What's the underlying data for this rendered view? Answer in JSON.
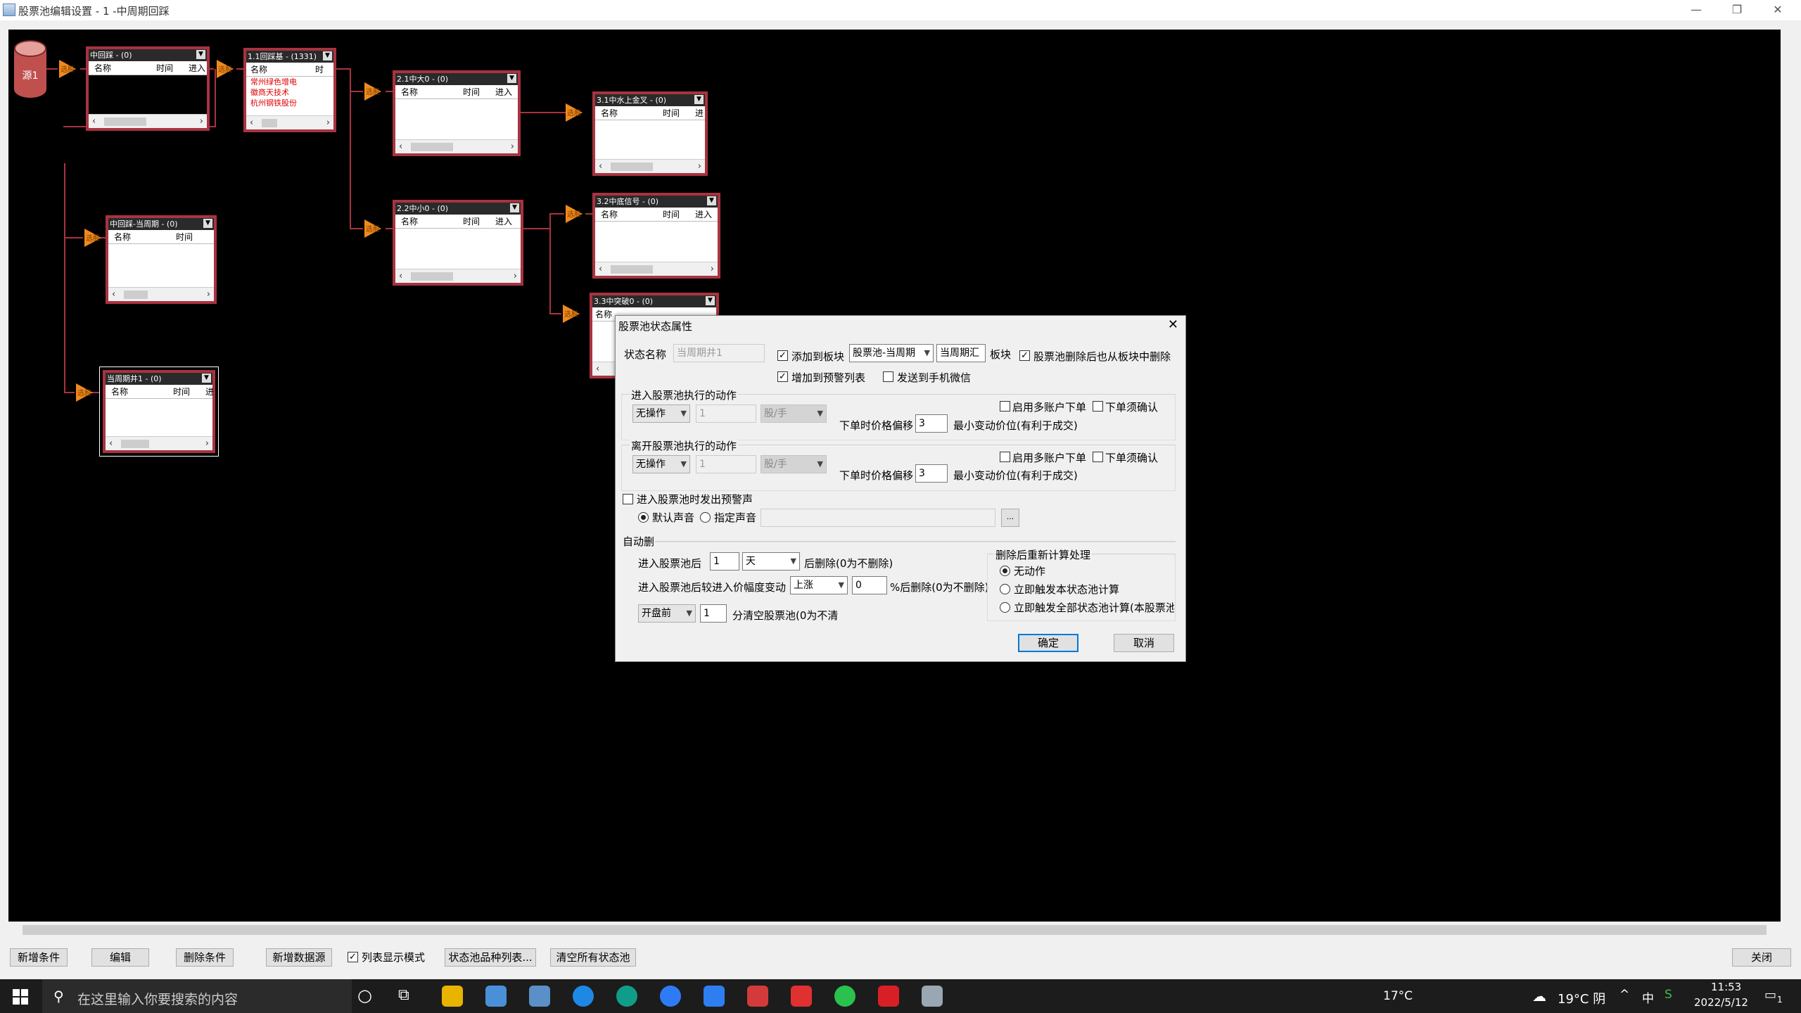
{
  "window": {
    "title": "股票池编辑设置 - 1 -中周期回踩",
    "controls": [
      "—",
      "❐",
      "✕"
    ]
  },
  "source_db": {
    "label": "源1"
  },
  "triangle_label": "选股",
  "pools": [
    {
      "id": "p-zhonghuicai",
      "title": "中回踩 - (0)",
      "cols": [
        "名称",
        "时间",
        "进入"
      ],
      "rows": []
    },
    {
      "id": "p-huicaijibase",
      "title": "1.1回踩基 - (1331)",
      "cols": [
        "名称",
        "时"
      ],
      "rows": [
        "常州绿色增电",
        "徽商天技术",
        "杭州钢铁股份"
      ]
    },
    {
      "id": "p-zhongda",
      "title": "2.1中大0 - (0)",
      "cols": [
        "名称",
        "时间",
        "进入"
      ],
      "rows": []
    },
    {
      "id": "p-shangjinhu",
      "title": "3.1中水上金叉 - (0)",
      "cols": [
        "名称",
        "时间",
        "进"
      ],
      "rows": []
    },
    {
      "id": "p-dangzhouqi",
      "title": "中回踩-当周期 - (0)",
      "cols": [
        "名称",
        "时间"
      ],
      "rows": []
    },
    {
      "id": "p-zhongxiao",
      "title": "2.2中小0 - (0)",
      "cols": [
        "名称",
        "时间",
        "进入"
      ],
      "rows": []
    },
    {
      "id": "p-dixinhao",
      "title": "3.2中底信号 - (0)",
      "cols": [
        "名称",
        "时间",
        "进入"
      ],
      "rows": []
    },
    {
      "id": "p-tupo",
      "title": "3.3中突破0 - (0)",
      "cols": [
        "名称"
      ],
      "rows": []
    },
    {
      "id": "p-dangzhouqijing",
      "title": "当周期井1 - (0)",
      "cols": [
        "名称",
        "时间",
        "进"
      ],
      "rows": []
    }
  ],
  "dialog": {
    "title": "股票池状态属性",
    "state_name_label": "状态名称",
    "state_name_value": "当周期井1",
    "add_to_block_label": "添加到板块",
    "add_to_block_checked": true,
    "block_select": "股票池-当周期",
    "block_name": "当周期汇",
    "block_suffix": "板块",
    "delete_from_block_label": "股票池删除后也从板块中删除",
    "delete_from_block_checked": true,
    "add_to_alert_label": "增加到预警列表",
    "add_to_alert_checked": true,
    "send_wechat_label": "发送到手机微信",
    "send_wechat_checked": false,
    "enter_section": {
      "title": "进入股票池执行的动作",
      "action": "无操作",
      "qty": "1",
      "unit": "股/手",
      "multi_account_label": "启用多账户下单",
      "confirm_label": "下单须确认",
      "offset_label": "下单时价格偏移",
      "offset_value": "3",
      "offset_suffix": "最小变动价位(有利于成交)"
    },
    "leave_section": {
      "title": "离开股票池执行的动作",
      "action": "无操作",
      "qty": "1",
      "unit": "股/手",
      "multi_account_label": "启用多账户下单",
      "confirm_label": "下单须确认",
      "offset_label": "下单时价格偏移",
      "offset_value": "3",
      "offset_suffix": "最小变动价位(有利于成交)"
    },
    "alert_sound_label": "进入股票池时发出预警声",
    "default_sound_label": "默认声音",
    "custom_sound_label": "指定声音",
    "browse_label": "...",
    "auto_delete": {
      "title": "自动删",
      "after_enter_label": "进入股票池后",
      "after_enter_value": "1",
      "after_enter_unit": "天",
      "after_enter_suffix": "后删除(0为不删除)",
      "price_change_label": "进入股票池后较进入价幅度变动",
      "price_change_dir": "上涨",
      "price_change_value": "0",
      "price_change_suffix": "%后删除(0为不删除)",
      "clear_select": "开盘前",
      "clear_value": "1",
      "clear_suffix": "分清空股票池(0为不清"
    },
    "recalc": {
      "title": "删除后重新计算处理",
      "options": [
        "无动作",
        "立即触发本状态池计算",
        "立即触发全部状态池计算(本股票池"
      ],
      "selected": 0
    },
    "ok_label": "确定",
    "cancel_label": "取消"
  },
  "toolbar": {
    "new_condition": "新增条件",
    "edit": "编辑",
    "delete_condition": "删除条件",
    "new_source": "新增数据源",
    "list_mode_label": "列表显示模式",
    "list_mode_checked": true,
    "pool_list": "状态池品种列表...",
    "clear_all": "清空所有状态池",
    "close": "关闭"
  },
  "taskbar": {
    "search_placeholder": "在这里输入你要搜索的内容",
    "weather_left": "17°C",
    "weather_right": "19°C 阴",
    "ime": "中",
    "time": "11:53",
    "date": "2022/5/12",
    "notification_count": "1"
  },
  "colors": {
    "pool_border": "#a8333f",
    "connector": "#a8333f",
    "triangle": "#f08a1c",
    "accent": "#0078d7"
  }
}
